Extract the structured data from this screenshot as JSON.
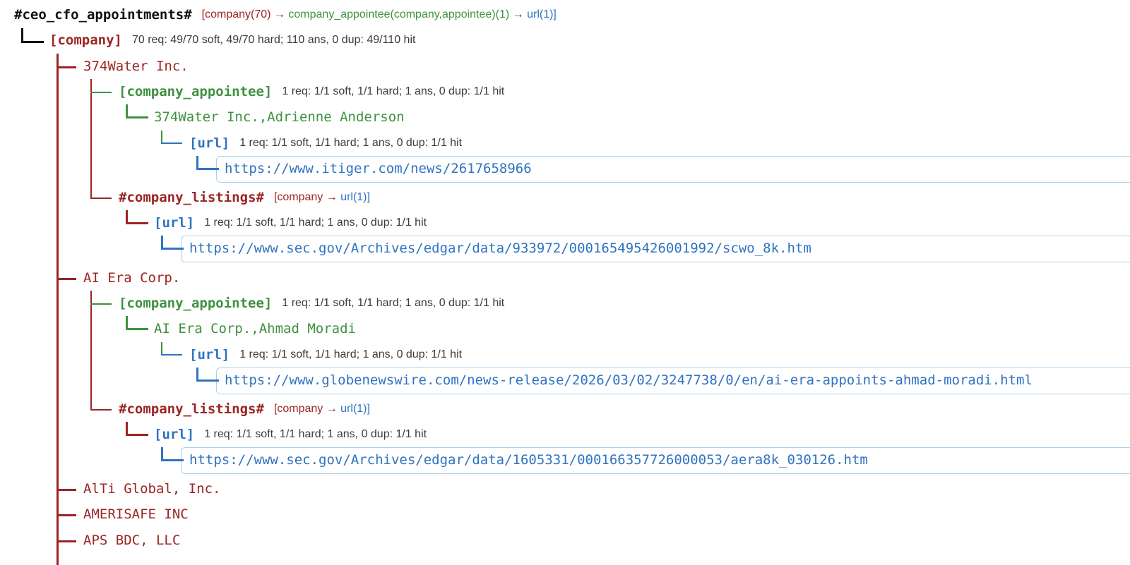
{
  "root": {
    "name": "#ceo_cfo_appointments#",
    "signature": {
      "part_company": "[company(70) →",
      "part_appointee": "company_appointee(company,appointee)(1)",
      "part_arrow": "→",
      "part_url": "url(1)]"
    }
  },
  "company_node": {
    "label": "[company]",
    "stats": "70 req: 49/70 soft, 49/70 hard; 110 ans, 0 dup: 49/110 hit"
  },
  "companies": [
    {
      "name": "374Water Inc.",
      "appointee_label": "[company_appointee]",
      "appointee_stats": "1 req: 1/1 soft, 1/1 hard; 1 ans, 0 dup: 1/1 hit",
      "appointee_value": "374Water Inc.,Adrienne Anderson",
      "appointee_url_label": "[url]",
      "appointee_url_stats": "1 req: 1/1 soft, 1/1 hard; 1 ans, 0 dup: 1/1 hit",
      "appointee_url": "https://www.itiger.com/news/2617658966",
      "listings_label": "#company_listings#",
      "listings_sig_company": "[company →",
      "listings_sig_url": "url(1)]",
      "listings_url_label": "[url]",
      "listings_url_stats": "1 req: 1/1 soft, 1/1 hard; 1 ans, 0 dup: 1/1 hit",
      "listings_url": "https://www.sec.gov/Archives/edgar/data/933972/000165495426001992/scwo_8k.htm"
    },
    {
      "name": "AI Era Corp.",
      "appointee_label": "[company_appointee]",
      "appointee_stats": "1 req: 1/1 soft, 1/1 hard; 1 ans, 0 dup: 1/1 hit",
      "appointee_value": "AI Era Corp.,Ahmad Moradi",
      "appointee_url_label": "[url]",
      "appointee_url_stats": "1 req: 1/1 soft, 1/1 hard; 1 ans, 0 dup: 1/1 hit",
      "appointee_url": "https://www.globenewswire.com/news-release/2026/03/02/3247738/0/en/ai-era-appoints-ahmad-moradi.html",
      "listings_label": "#company_listings#",
      "listings_sig_company": "[company →",
      "listings_sig_url": "url(1)]",
      "listings_url_label": "[url]",
      "listings_url_stats": "1 req: 1/1 soft, 1/1 hard; 1 ans, 0 dup: 1/1 hit",
      "listings_url": "https://www.sec.gov/Archives/edgar/data/1605331/000166357726000053/aera8k_030126.htm"
    }
  ],
  "collapsed_companies": [
    "AlTi Global, Inc.",
    "AMERISAFE INC",
    "APS BDC, LLC"
  ],
  "colors": {
    "company": "#9b2523",
    "appointee": "#3f9140",
    "url": "#2f73c2",
    "url_box_border": "#a9d2ee"
  }
}
